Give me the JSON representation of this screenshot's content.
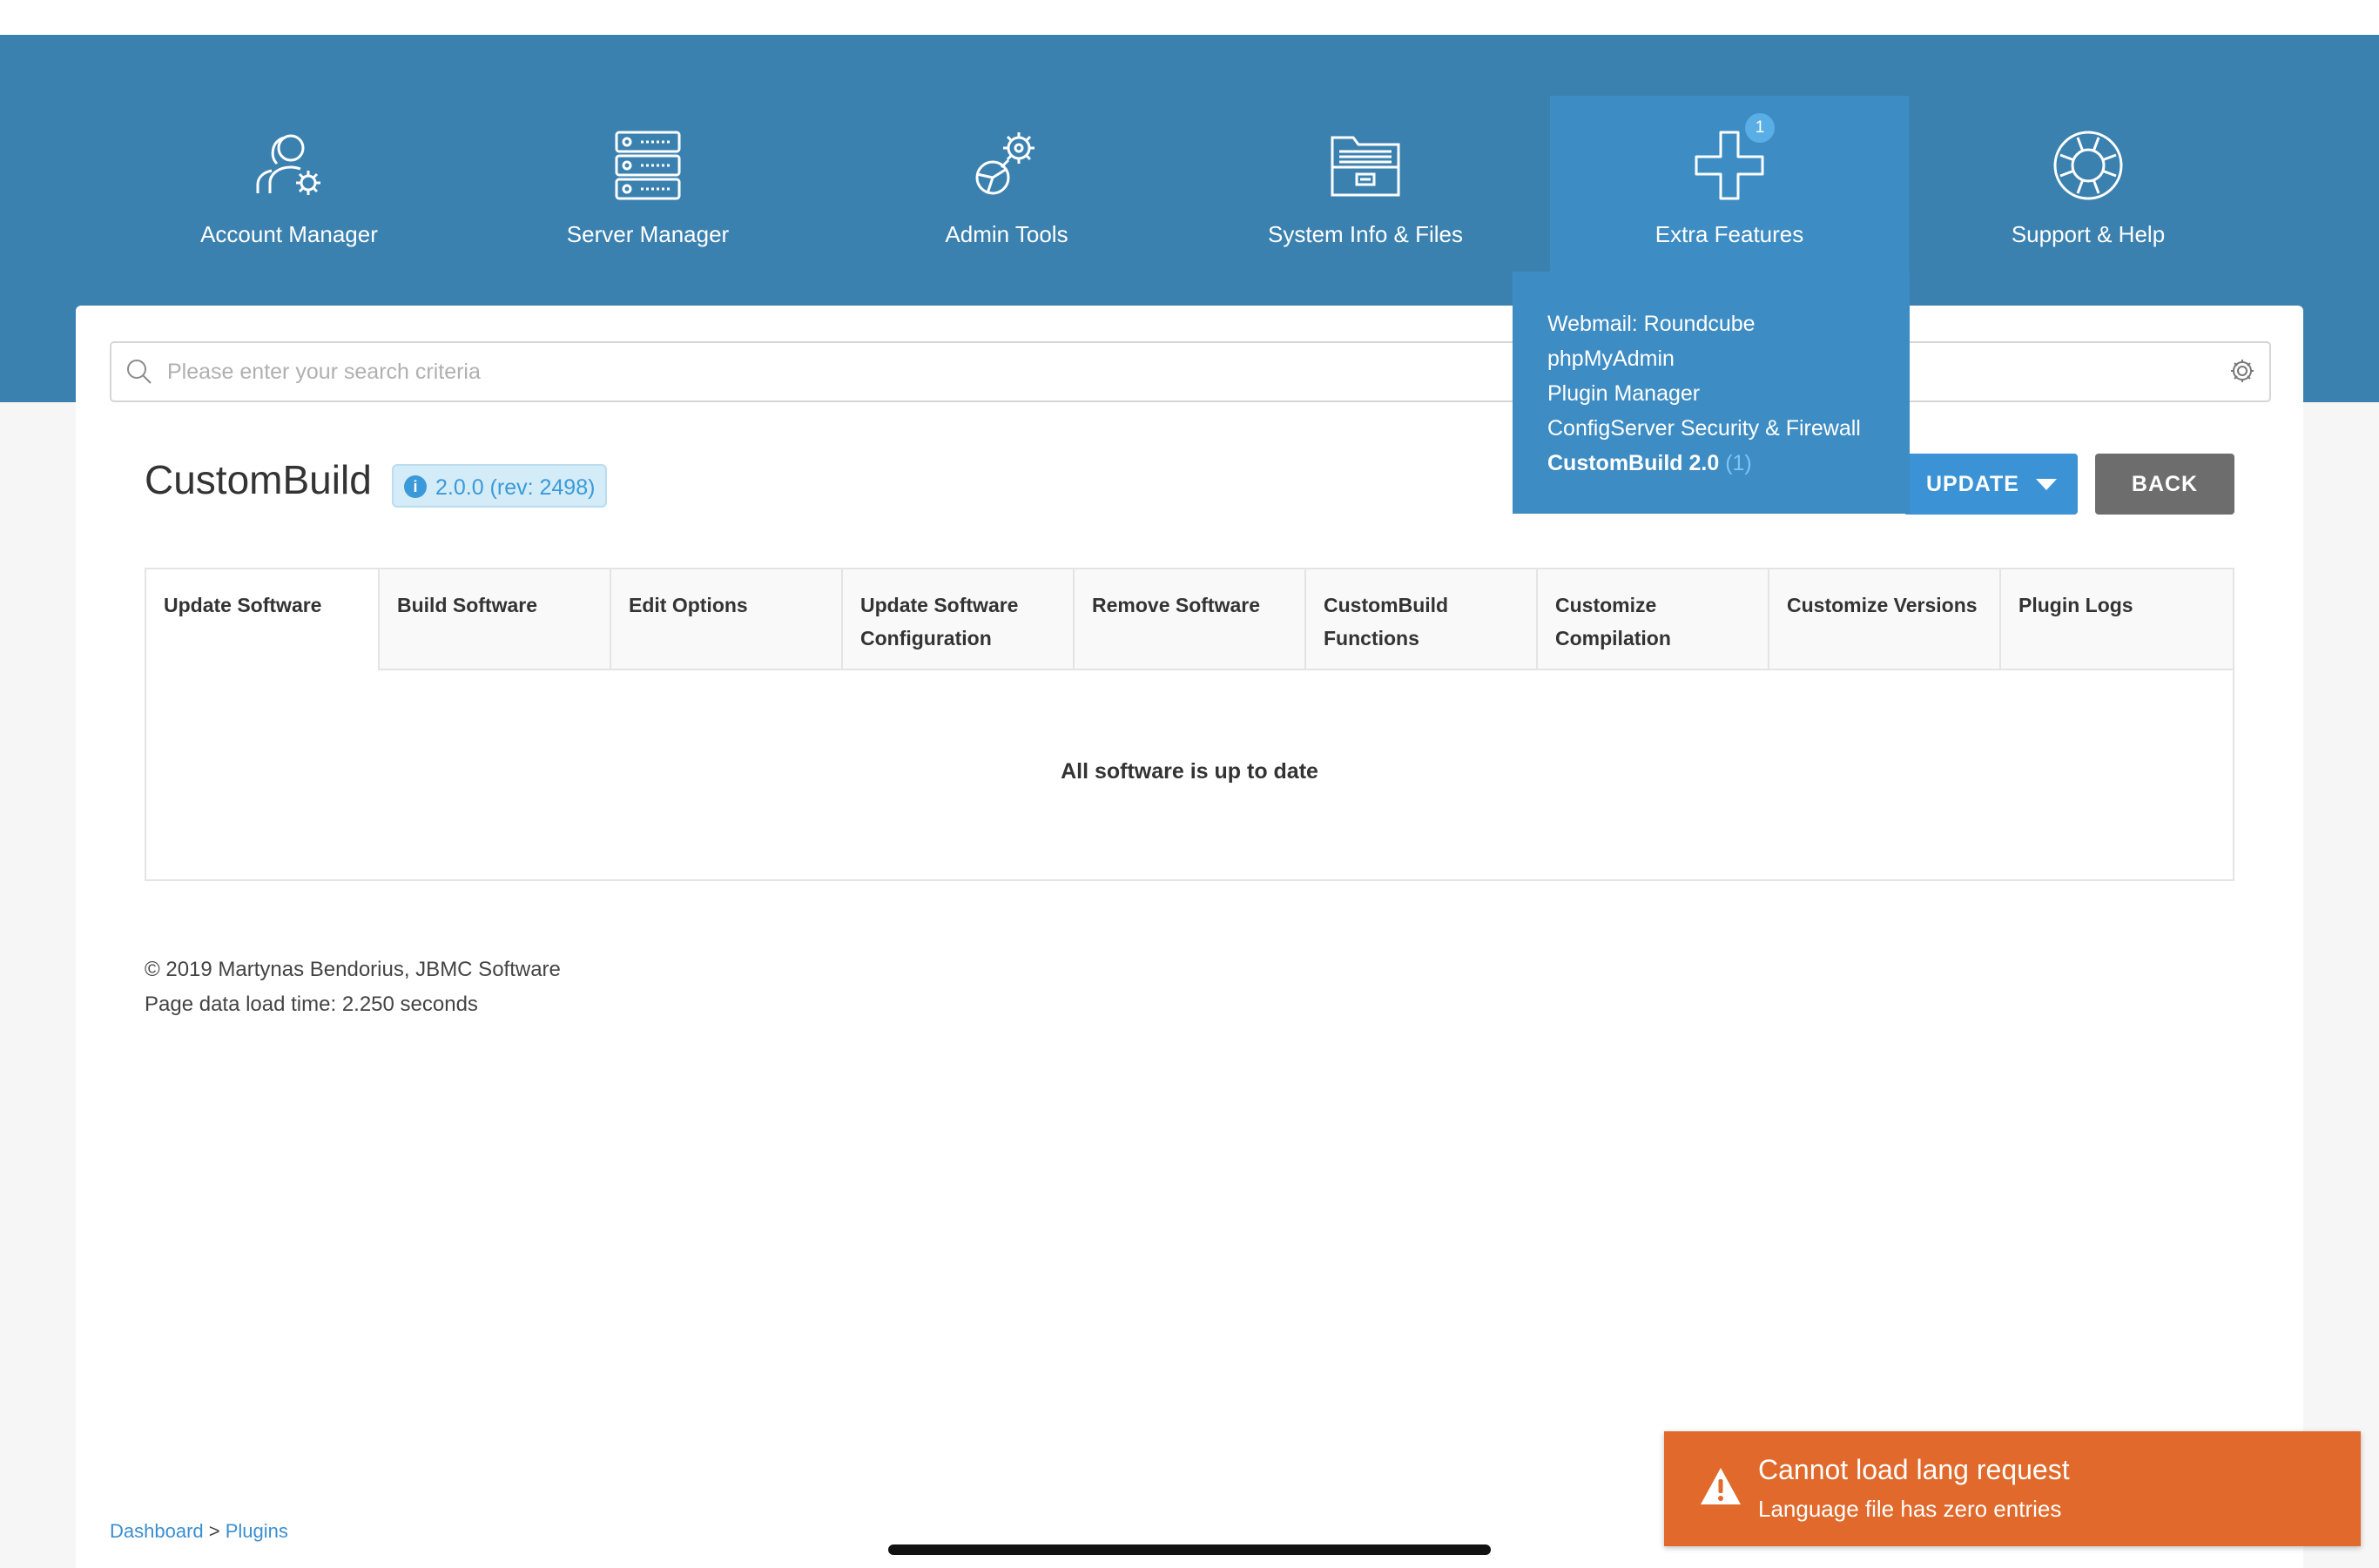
{
  "nav": {
    "items": [
      {
        "label": "Account Manager",
        "icon": "account-manager-icon"
      },
      {
        "label": "Server Manager",
        "icon": "server-icon"
      },
      {
        "label": "Admin Tools",
        "icon": "admin-tools-icon"
      },
      {
        "label": "System Info & Files",
        "icon": "folder-icon"
      },
      {
        "label": "Extra Features",
        "icon": "plus-icon",
        "badge": "1",
        "active": true
      },
      {
        "label": "Support & Help",
        "icon": "lifebuoy-icon"
      }
    ]
  },
  "extra_features_menu": {
    "items": [
      {
        "label": "Webmail: Roundcube"
      },
      {
        "label": "phpMyAdmin"
      },
      {
        "label": "Plugin Manager"
      },
      {
        "label": "ConfigServer Security & Firewall"
      },
      {
        "label": "CustomBuild 2.0",
        "count": "(1)",
        "active": true
      }
    ]
  },
  "search": {
    "placeholder": "Please enter your search criteria",
    "value": ""
  },
  "page": {
    "title": "CustomBuild",
    "version": "2.0.0 (rev: 2498)"
  },
  "actions": {
    "update_label": "UPDATE",
    "back_label": "BACK"
  },
  "tabs": [
    {
      "label": "Update Software",
      "active": true
    },
    {
      "label": "Build Software"
    },
    {
      "label": "Edit Options"
    },
    {
      "label": "Update Software Configuration"
    },
    {
      "label": "Remove Software"
    },
    {
      "label": "CustomBuild Functions"
    },
    {
      "label": "Customize Compilation"
    },
    {
      "label": "Customize Versions"
    },
    {
      "label": "Plugin Logs"
    }
  ],
  "tab_content": {
    "message": "All software is up to date"
  },
  "footer": {
    "copyright": "© 2019 Martynas Bendorius, JBMC Software",
    "load_time": "Page data load time: 2.250 seconds"
  },
  "breadcrumb": {
    "items": [
      "Dashboard",
      "Plugins"
    ],
    "separator": ">"
  },
  "toast": {
    "title": "Cannot load lang request",
    "message": "Language file has zero entries",
    "color": "#e0692b"
  },
  "colors": {
    "nav_bg": "#3b81b0",
    "accent": "#3b93d6",
    "back_button": "#6d6d6d"
  }
}
